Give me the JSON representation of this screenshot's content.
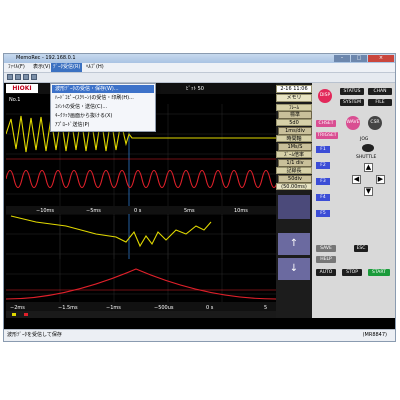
{
  "window": {
    "title": "MemoRec - 192.168.0.1"
  },
  "menu": {
    "items": [
      "ﾌｧｲﾙ(F)",
      "表示(V)",
      "ﾃﾞｰﾀ受信(R)",
      "ﾍﾙﾌﾟ(H)"
    ],
    "active_index": 2,
    "dropdown": [
      "波形ﾃﾞｰﾀの受信・保存(W)...",
      "ﾊｰﾄﾞｺﾋﾟｰ(ｽｸﾘｰﾝ)の受信・印刷(H)...",
      "ｺﾒﾝﾄの受信・送信(C)...",
      "ｷｰｸﾘｯｸ画面から抜ける(X)",
      "ｱﾌﾟﾛｰﾄﾞ送信(P)"
    ]
  },
  "header": {
    "brand": "HIOKI",
    "ch_label": "No.1",
    "trigger_time": "2-16 11:06",
    "mode": "メモリ"
  },
  "upper_axis": {
    "ticks": [
      "−10ms",
      "−5ms",
      "0 s",
      "5ms",
      "10ms"
    ]
  },
  "lower_axis": {
    "ticks": [
      "−2ms",
      "−1.5ms",
      "−1ms",
      "−500us",
      "0 s",
      "5"
    ]
  },
  "settings_panel": {
    "label1": "ﾌﾚｰﾑ",
    "value1": "標準",
    "label2": "5d0",
    "value2": "1ms/div",
    "label3": "時間軸",
    "value3": "1Ms/S",
    "label4": "ｽﾞｰﾑ倍率",
    "value4": "1/1 div",
    "label5": "記録長",
    "value5": "50div",
    "label6": "(50.00ms)"
  },
  "control": {
    "disp": "DISP",
    "status": "STATUS",
    "chan": "CHAN",
    "system": "SYSTEM",
    "file": "FILE",
    "chset": "CHSET",
    "wave": "WAVE",
    "csr": "CSR",
    "trigset": "TRIGSET",
    "jog": "JOG",
    "shuttle": "SHUTTLE",
    "f_keys": [
      "F1",
      "F2",
      "F3",
      "F4",
      "F5"
    ],
    "save": "SAVE",
    "esc": "ESC",
    "help": "HELP",
    "auto": "AUTO",
    "stop": "STOP",
    "start": "START"
  },
  "status_bar": {
    "text": "波形ﾃﾞｰﾀを受信して保存",
    "model": "(MR8847)"
  },
  "colors": {
    "yellow": "#e0d800",
    "red": "#e0202a",
    "accent": "#3d72c9"
  }
}
